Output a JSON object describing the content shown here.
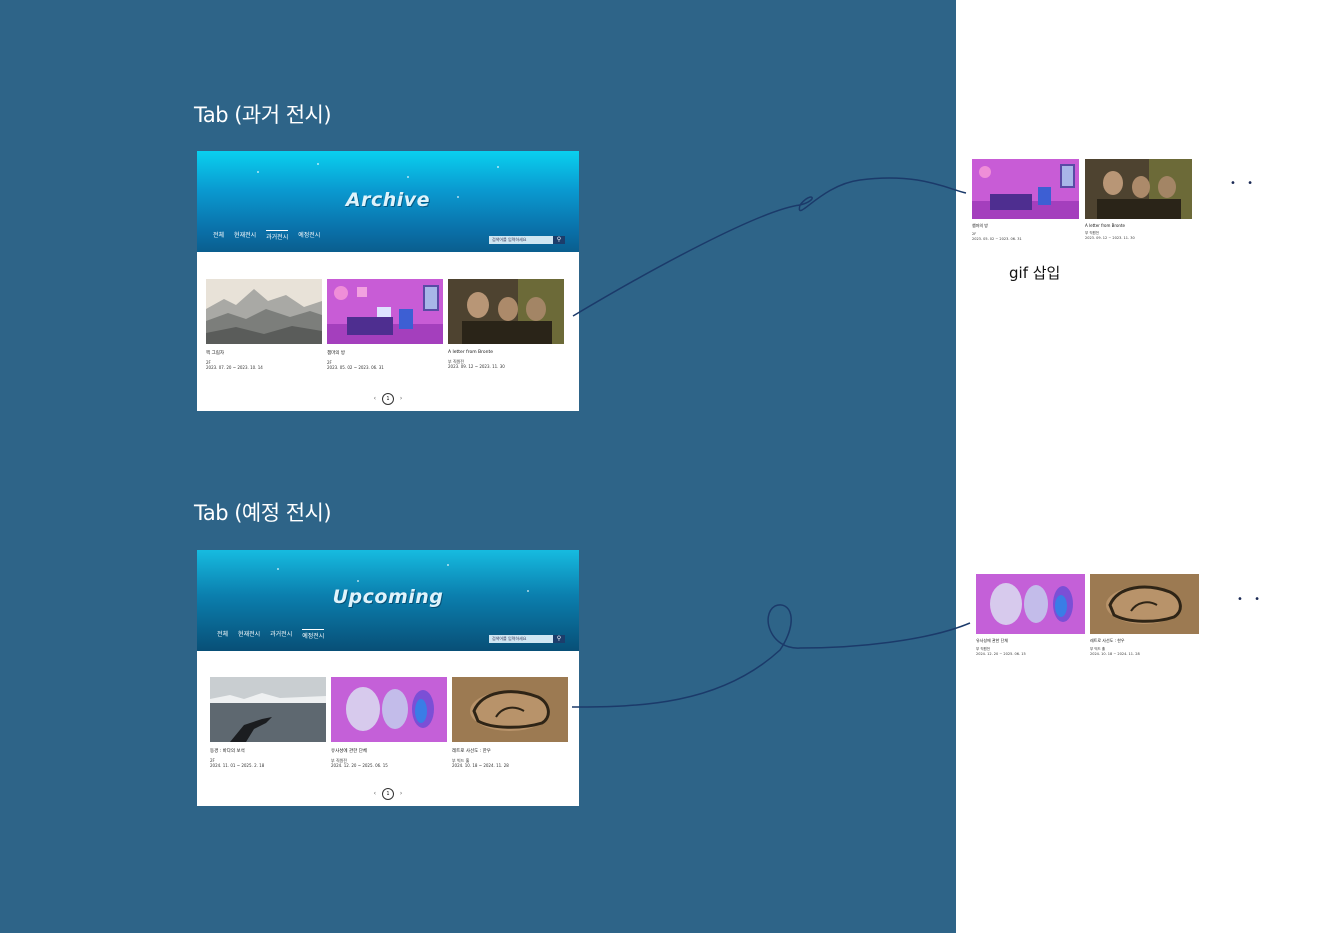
{
  "labels": {
    "archive_tab": "Tab (과거 전시)",
    "upcoming_tab": "Tab (예정 전시)",
    "gif_note": "gif 삽입",
    "more": "• •"
  },
  "archive": {
    "hero_title": "Archive",
    "nav": [
      "전체",
      "현재전시",
      "과거전시",
      "예정전시"
    ],
    "active_nav": "과거전시",
    "search_placeholder": "검색어를 입력하세요",
    "cards": [
      {
        "title": "찍 그림자",
        "venue": "2F",
        "dates": "2023. 07. 20 ~ 2023. 10. 14"
      },
      {
        "title": "챔마의 방",
        "venue": "2F",
        "dates": "2023. 05. 02 ~ 2023. 06. 31"
      },
      {
        "title": "A letter from Bronte",
        "venue": "부 직원전",
        "dates": "2023. 09. 12 ~ 2023. 11. 30"
      }
    ],
    "page": "1"
  },
  "upcoming": {
    "hero_title": "Upcoming",
    "nav": [
      "전체",
      "현재전시",
      "과거전시",
      "예정전시"
    ],
    "active_nav": "예정전시",
    "search_placeholder": "검색어를 입력하세요",
    "cards": [
      {
        "title": "동경 : 바다의 보석",
        "venue": "2F",
        "dates": "2024. 11. 01 ~ 2025. 2. 18"
      },
      {
        "title": "유사성에 관한 단체",
        "venue": "부 직원전",
        "dates": "2024. 12. 20 ~ 2025. 06. 15"
      },
      {
        "title": "레트로 사선도 : 한우",
        "venue": "부 빅드 홀",
        "dates": "2024. 10. 18 ~ 2024. 11. 28"
      }
    ],
    "page": "1"
  },
  "archive_gif": [
    {
      "title": "챔마의 방",
      "venue": "2F",
      "dates": "2023. 05. 02 ~ 2023. 06. 31"
    },
    {
      "title": "A letter from Bronte",
      "venue": "부 직원전",
      "dates": "2023. 09. 12 ~ 2023. 11. 30"
    }
  ],
  "upcoming_gif": [
    {
      "title": "유사성에 관한 단체",
      "venue": "부 직원전",
      "dates": "2024. 12. 20 ~ 2025. 06. 15"
    },
    {
      "title": "레트로 사선도 : 한우",
      "venue": "부 빅드 홀",
      "dates": "2024. 10. 18 ~ 2024. 11. 28"
    }
  ],
  "pager": {
    "prev": "‹",
    "next": "›"
  },
  "colors": {
    "background": "#2e6488",
    "panel": "#ffffff",
    "curve": "#1b3a6a"
  }
}
